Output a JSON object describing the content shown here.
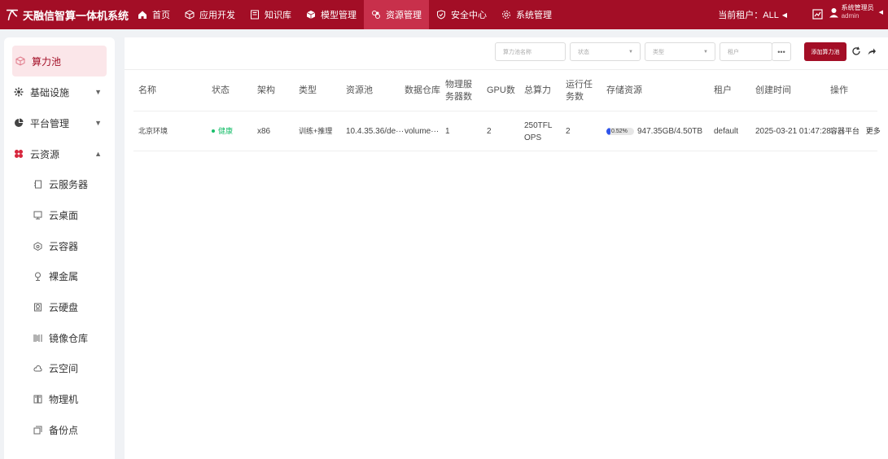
{
  "brand": {
    "name": "天融信智算一体机系统"
  },
  "nav": [
    {
      "label": "首页",
      "icon": "home-icon",
      "active": false
    },
    {
      "label": "应用开发",
      "icon": "cube-icon",
      "active": false
    },
    {
      "label": "知识库",
      "icon": "book-icon",
      "active": false
    },
    {
      "label": "模型管理",
      "icon": "model-icon",
      "active": false
    },
    {
      "label": "资源管理",
      "icon": "resource-icon",
      "active": true
    },
    {
      "label": "安全中心",
      "icon": "shield-icon",
      "active": false
    },
    {
      "label": "系统管理",
      "icon": "gear-icon",
      "active": false
    }
  ],
  "header": {
    "tenant_label": "当前租户：ALL",
    "user_role": "系统管理员",
    "user_name": "admin"
  },
  "sidebar": {
    "items": [
      {
        "label": "算力池",
        "icon": "compute-pool-icon",
        "active": true
      },
      {
        "label": "基础设施",
        "icon": "infrastructure-icon",
        "arrow": "▼"
      },
      {
        "label": "平台管理",
        "icon": "platform-icon",
        "arrow": "▼"
      },
      {
        "label": "云资源",
        "icon": "cloud-resource-icon",
        "arrow": "▲"
      }
    ],
    "subitems": [
      {
        "label": "云服务器",
        "icon": "server-icon"
      },
      {
        "label": "云桌面",
        "icon": "desktop-icon"
      },
      {
        "label": "云容器",
        "icon": "container-icon"
      },
      {
        "label": "裸金属",
        "icon": "bare-metal-icon"
      },
      {
        "label": "云硬盘",
        "icon": "disk-icon"
      },
      {
        "label": "镜像仓库",
        "icon": "image-repo-icon"
      },
      {
        "label": "云空间",
        "icon": "cloud-space-icon"
      },
      {
        "label": "物理机",
        "icon": "physical-machine-icon"
      },
      {
        "label": "备份点",
        "icon": "backup-icon"
      }
    ]
  },
  "filters": {
    "name_placeholder": "算力池名称",
    "status_placeholder": "状态",
    "type_placeholder": "类型",
    "tenant_placeholder": "租户",
    "more_label": "•••",
    "add_label": "添加算力池"
  },
  "table": {
    "headers": {
      "name": "名称",
      "status": "状态",
      "arch": "架构",
      "type": "类型",
      "pool": "资源池",
      "datastore": "数据仓库",
      "servers": "物理服务器数",
      "gpu": "GPU数",
      "compute": "总算力",
      "tasks": "运行任务数",
      "storage": "存储资源",
      "tenant": "租户",
      "created": "创建时间",
      "ops": "操作"
    },
    "rows": [
      {
        "name": "北京环境",
        "status": "健康",
        "arch": "x86",
        "type": "训练+推理",
        "pool": "10.4.35.36/de···",
        "datastore": "volume···",
        "servers": "1",
        "gpu": "2",
        "compute": "250TFLOPS",
        "tasks": "2",
        "storage_pct": "0.52%",
        "storage_fraction": 0.0052,
        "storage": "947.35GB/4.50TB",
        "tenant": "default",
        "created": "2025-03-21 01:47:28",
        "op1": "容器平台",
        "op2": "更多"
      }
    ]
  },
  "colors": {
    "brand": "#a30e26",
    "nav_active": "#c8304b",
    "healthy": "#19be6b",
    "storage_bar": "#2f54eb"
  }
}
